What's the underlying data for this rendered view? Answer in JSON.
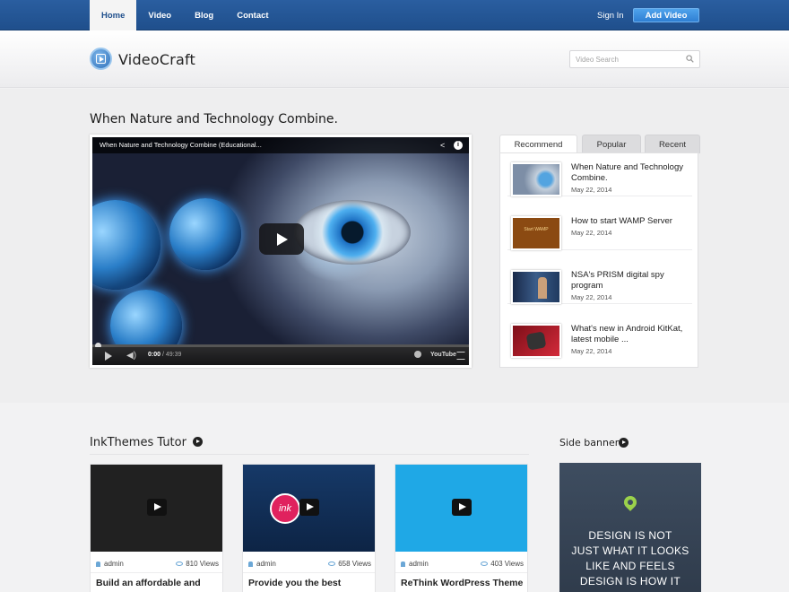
{
  "nav": {
    "items": [
      {
        "label": "Home",
        "active": true
      },
      {
        "label": "Video",
        "active": false
      },
      {
        "label": "Blog",
        "active": false
      },
      {
        "label": "Contact",
        "active": false
      }
    ],
    "signin": "Sign In",
    "add_video": "Add Video"
  },
  "header": {
    "site_name": "VideoCraft",
    "logo_icon": "play-square-icon",
    "search_placeholder": "Video Search",
    "search_icon": "search-icon"
  },
  "hero": {
    "title": "When Nature and Technology Combine.",
    "player": {
      "video_title": "When Nature and Technology Combine (Educational...",
      "current_time": "0:00",
      "separator": " / ",
      "duration": "49:39",
      "brand": "YouTube"
    }
  },
  "tabs": {
    "labels": [
      "Recommend",
      "Popular",
      "Recent"
    ],
    "active": "Recommend",
    "items": [
      {
        "title": "When Nature and Technology Combine.",
        "date": "May 22, 2014"
      },
      {
        "title": "How to start WAMP Server",
        "date": "May 22, 2014",
        "thumb_text": "Start WAMP"
      },
      {
        "title": "NSA's PRISM digital spy program",
        "date": "May 22, 2014"
      },
      {
        "title": "What's new in Android KitKat, latest mobile ...",
        "date": "May 22, 2014"
      }
    ]
  },
  "section": {
    "title": "InkThemes Tutor",
    "cards": [
      {
        "author": "admin",
        "views": "810 Views",
        "title": "Build an affordable and professional website"
      },
      {
        "author": "admin",
        "views": "658 Views",
        "title": "Provide you the best WordPress Themes",
        "thumb_text": "ink"
      },
      {
        "author": "admin",
        "views": "403 Views",
        "title": "ReThink WordPress Theme for Products Review"
      }
    ]
  },
  "sidebar": {
    "title": "Side banner",
    "banner_lines": [
      "DESIGN IS NOT",
      "JUST WHAT IT LOOKS",
      "LIKE AND FEELS",
      "DESIGN IS HOW IT"
    ]
  },
  "colors": {
    "nav_bg": "#1f4f8c",
    "accent": "#2f7fd3",
    "banner_bg": "#3e4d60",
    "pin": "#9bd24b"
  }
}
